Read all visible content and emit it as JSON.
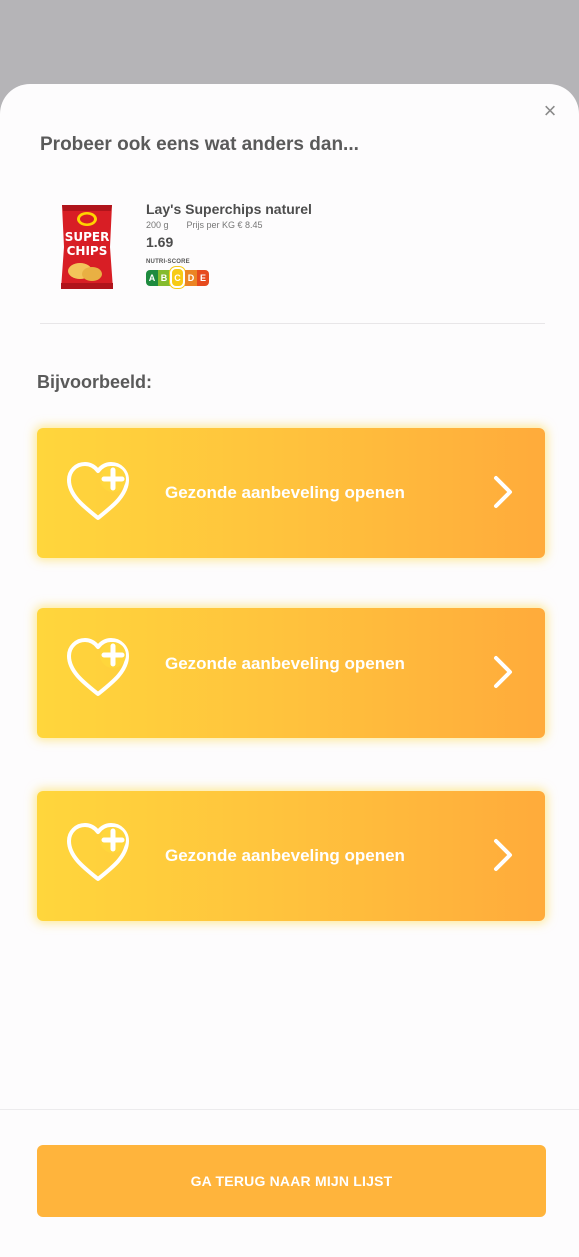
{
  "overlay": {
    "close_icon": "×"
  },
  "heading": "Probeer ook eens wat anders dan...",
  "product": {
    "name": "Lay's Superchips naturel",
    "weight": "200 g",
    "price_per_kg": "Prijs per KG € 8.45",
    "price": "1.69",
    "image_icon": "chips-bag-image",
    "nutri_score": {
      "label": "NUTRI-SCORE",
      "grades": [
        "A",
        "B",
        "C",
        "D",
        "E"
      ],
      "selected": "C",
      "colors": [
        "#1e8b3f",
        "#84bb2e",
        "#f7cb15",
        "#eb8423",
        "#e64a1e"
      ]
    }
  },
  "subheading": "Bijvoorbeeld:",
  "recommendations": [
    {
      "label": "Gezonde aanbeveling openen",
      "icon": "heart-plus-icon",
      "arrow": "chevron-right-icon"
    },
    {
      "label": "Gezonde aanbeveling openen",
      "icon": "heart-plus-icon",
      "arrow": "chevron-right-icon"
    },
    {
      "label": "Gezonde aanbeveling openen",
      "icon": "heart-plus-icon",
      "arrow": "chevron-right-icon"
    }
  ],
  "back_button": "GA TERUG NAAR MIJN LIJST",
  "colors": {
    "accent": "#ffb43c",
    "card_start": "#ffd63c",
    "card_end": "#ffab3b",
    "backdrop": "#b5b4b7"
  }
}
